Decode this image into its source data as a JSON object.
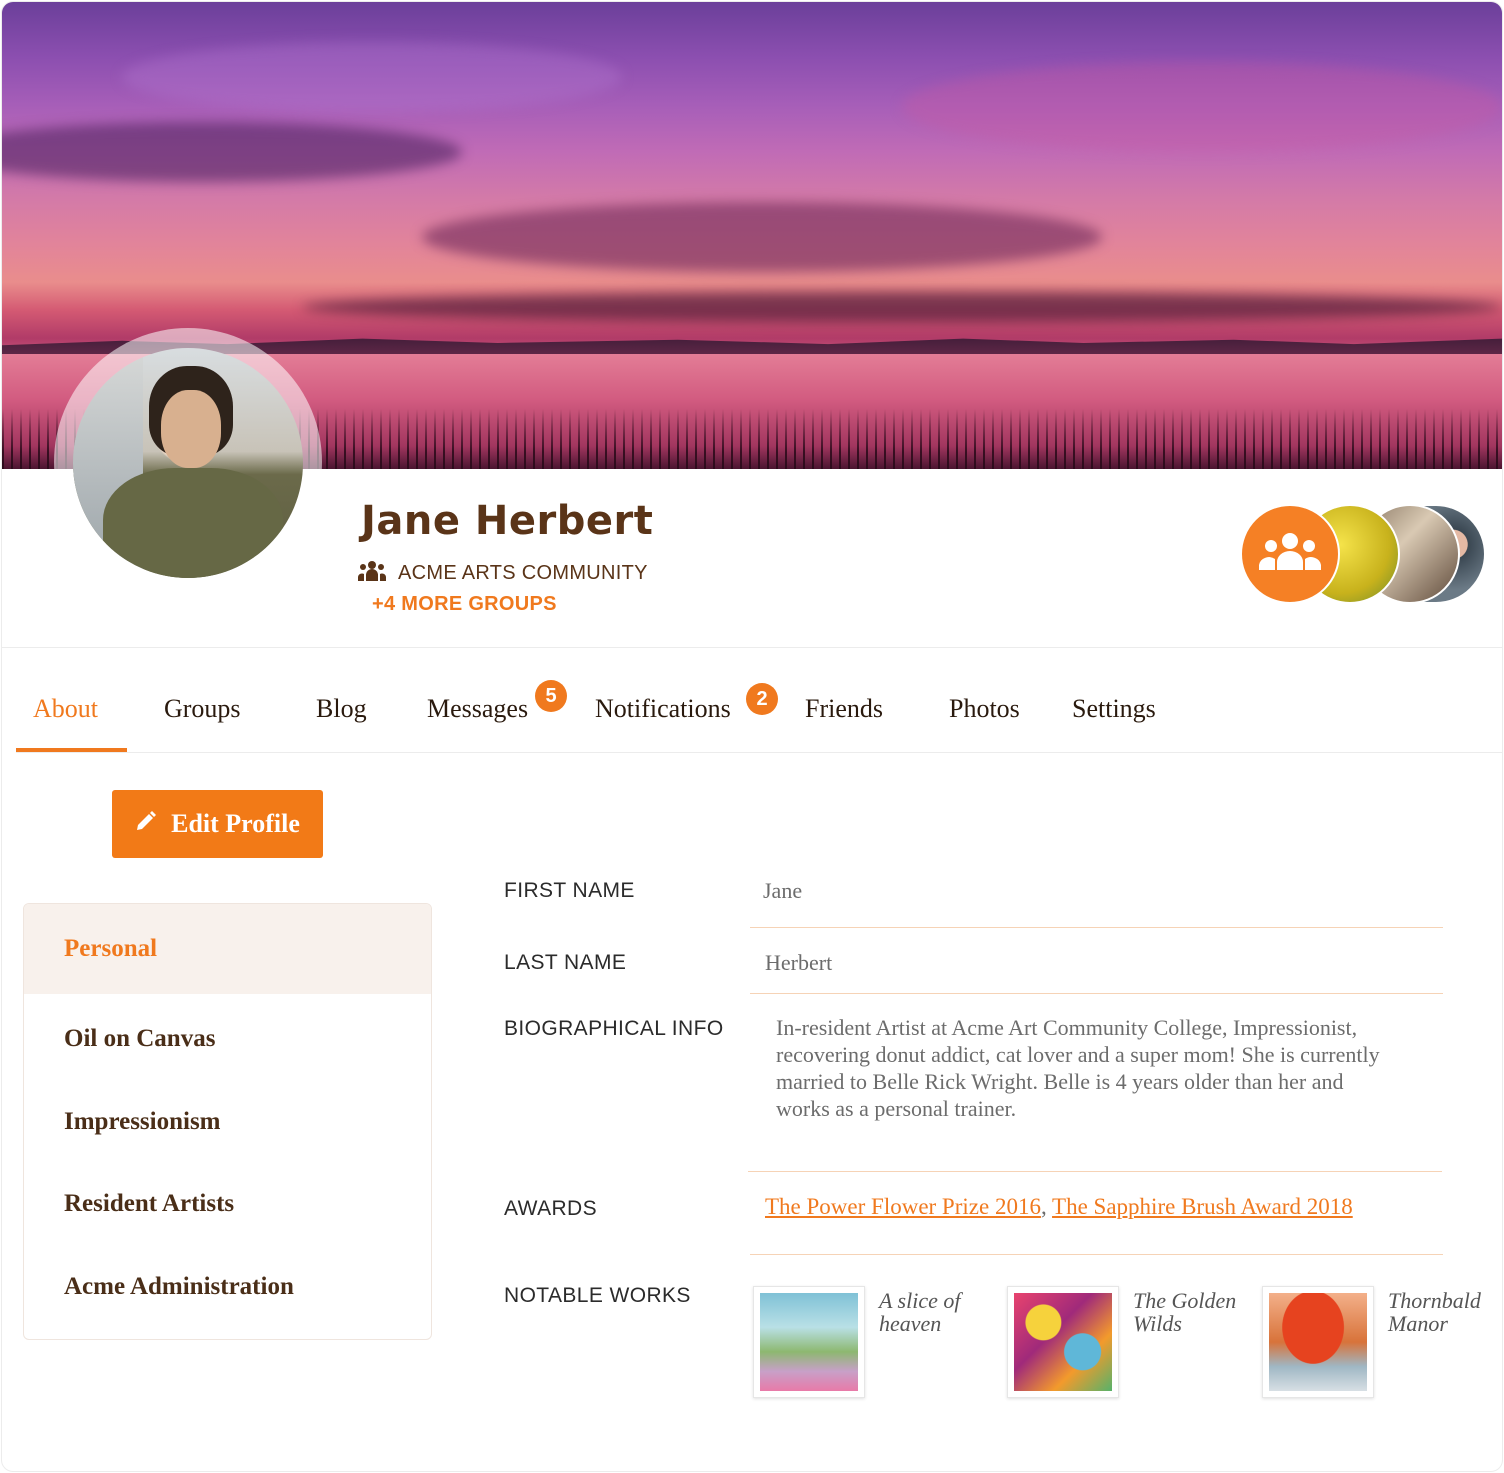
{
  "profile": {
    "name": "Jane Herbert",
    "group": "ACME ARTS COMMUNITY",
    "more_groups": "+4 MORE GROUPS"
  },
  "tabs": [
    {
      "label": "About",
      "active": true
    },
    {
      "label": "Groups"
    },
    {
      "label": "Blog"
    },
    {
      "label": "Messages",
      "badge": "5"
    },
    {
      "label": "Notifications",
      "badge": "2"
    },
    {
      "label": "Friends"
    },
    {
      "label": "Photos"
    },
    {
      "label": "Settings"
    }
  ],
  "edit_button": "Edit Profile",
  "side_menu": [
    "Personal",
    "Oil on Canvas",
    "Impressionism",
    "Resident Artists",
    "Acme Administration"
  ],
  "fields": {
    "first_name_label": "FIRST NAME",
    "first_name": "Jane",
    "last_name_label": "LAST NAME",
    "last_name": "Herbert",
    "bio_label": "BIOGRAPHICAL INFO",
    "bio": "In-resident Artist at Acme Art Community College, Impressionist, recovering donut addict, cat lover and a super mom! She is currently married to Belle Rick Wright. Belle is 4 years older than her and works as a personal trainer.",
    "awards_label": "AWARDS",
    "awards": [
      "The Power Flower Prize 2016",
      "The Sapphire Brush Award 2018"
    ],
    "awards_separator": ", ",
    "works_label": "NOTABLE WORKS",
    "works": [
      "A slice of heaven",
      "The Golden Wilds",
      "Thornbald Manor"
    ]
  },
  "colors": {
    "accent": "#f0791e",
    "brown": "#5a3418"
  },
  "icons": {
    "group": "group-icon",
    "pencil": "pencil-icon",
    "groups_stack": "people-icon"
  }
}
